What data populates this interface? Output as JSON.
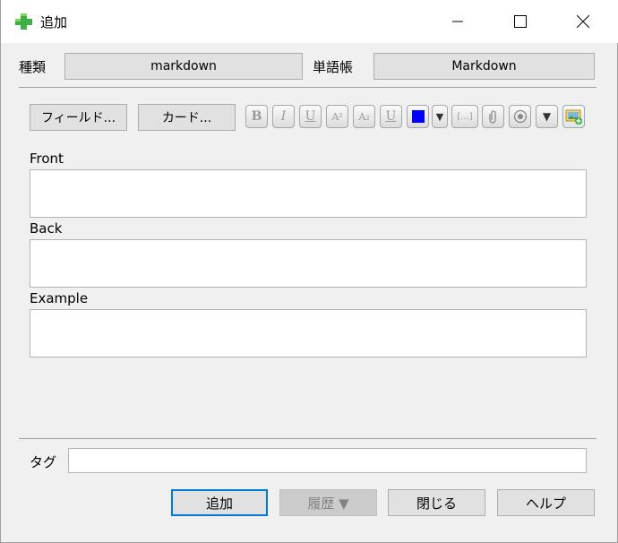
{
  "window": {
    "title": "追加",
    "minimize_glyph": "—",
    "maximize_glyph": "☐",
    "close_glyph": "✕"
  },
  "header": {
    "type_label": "種類",
    "type_value": "markdown",
    "deck_label": "単語帳",
    "deck_value": "Markdown"
  },
  "toolbar": {
    "fields_button": "フィールド...",
    "cards_button": "カード...",
    "bold": "B",
    "italic": "I",
    "underline": "U",
    "superscript": "A²",
    "subscript": "A₂",
    "clear_format": "U",
    "color_swatch": "#0000ff",
    "dropdown": "▼",
    "cloze": "[...]",
    "attach": "📎",
    "record": "◉",
    "more_dropdown": "▼",
    "image_icon": "image-add-icon"
  },
  "fields": [
    {
      "label": "Front",
      "value": ""
    },
    {
      "label": "Back",
      "value": ""
    },
    {
      "label": "Example",
      "value": ""
    }
  ],
  "tags": {
    "label": "タグ",
    "value": ""
  },
  "buttons": {
    "add": "追加",
    "history": "履歴 ▼",
    "close": "閉じる",
    "help": "ヘルプ"
  }
}
